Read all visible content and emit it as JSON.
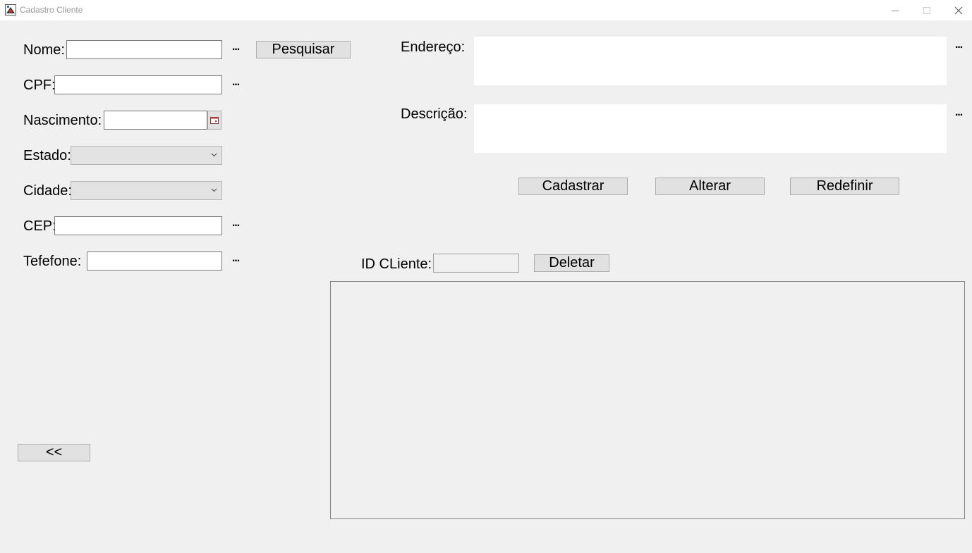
{
  "window": {
    "title": "Cadastro Cliente",
    "icons": {
      "app": "java-app-icon",
      "minimize": "minimize-icon",
      "maximize": "maximize-icon",
      "close": "close-icon"
    }
  },
  "form": {
    "nome": {
      "label": "Nome:",
      "value": "",
      "more": "..."
    },
    "cpf": {
      "label": "CPF:",
      "value": "",
      "more": "..."
    },
    "nascimento": {
      "label": "Nascimento:",
      "value": "",
      "icon": "calendar-icon"
    },
    "estado": {
      "label": "Estado:",
      "selected": ""
    },
    "cidade": {
      "label": "Cidade:",
      "selected": ""
    },
    "cep": {
      "label": "CEP:",
      "value": "",
      "more": "..."
    },
    "telefone": {
      "label": "Tefefone:",
      "value": "",
      "more": "..."
    },
    "endereco": {
      "label": "Endereço:",
      "value": "",
      "more": "..."
    },
    "descricao": {
      "label": "Descrição:",
      "value": "",
      "more": "..."
    }
  },
  "buttons": {
    "pesquisar": "Pesquisar",
    "cadastrar": "Cadastrar",
    "alterar": "Alterar",
    "redefinir": "Redefinir",
    "deletar": "Deletar",
    "back": "<<"
  },
  "id_cliente": {
    "label": "ID CLiente:",
    "value": ""
  },
  "table": {
    "rows": []
  }
}
